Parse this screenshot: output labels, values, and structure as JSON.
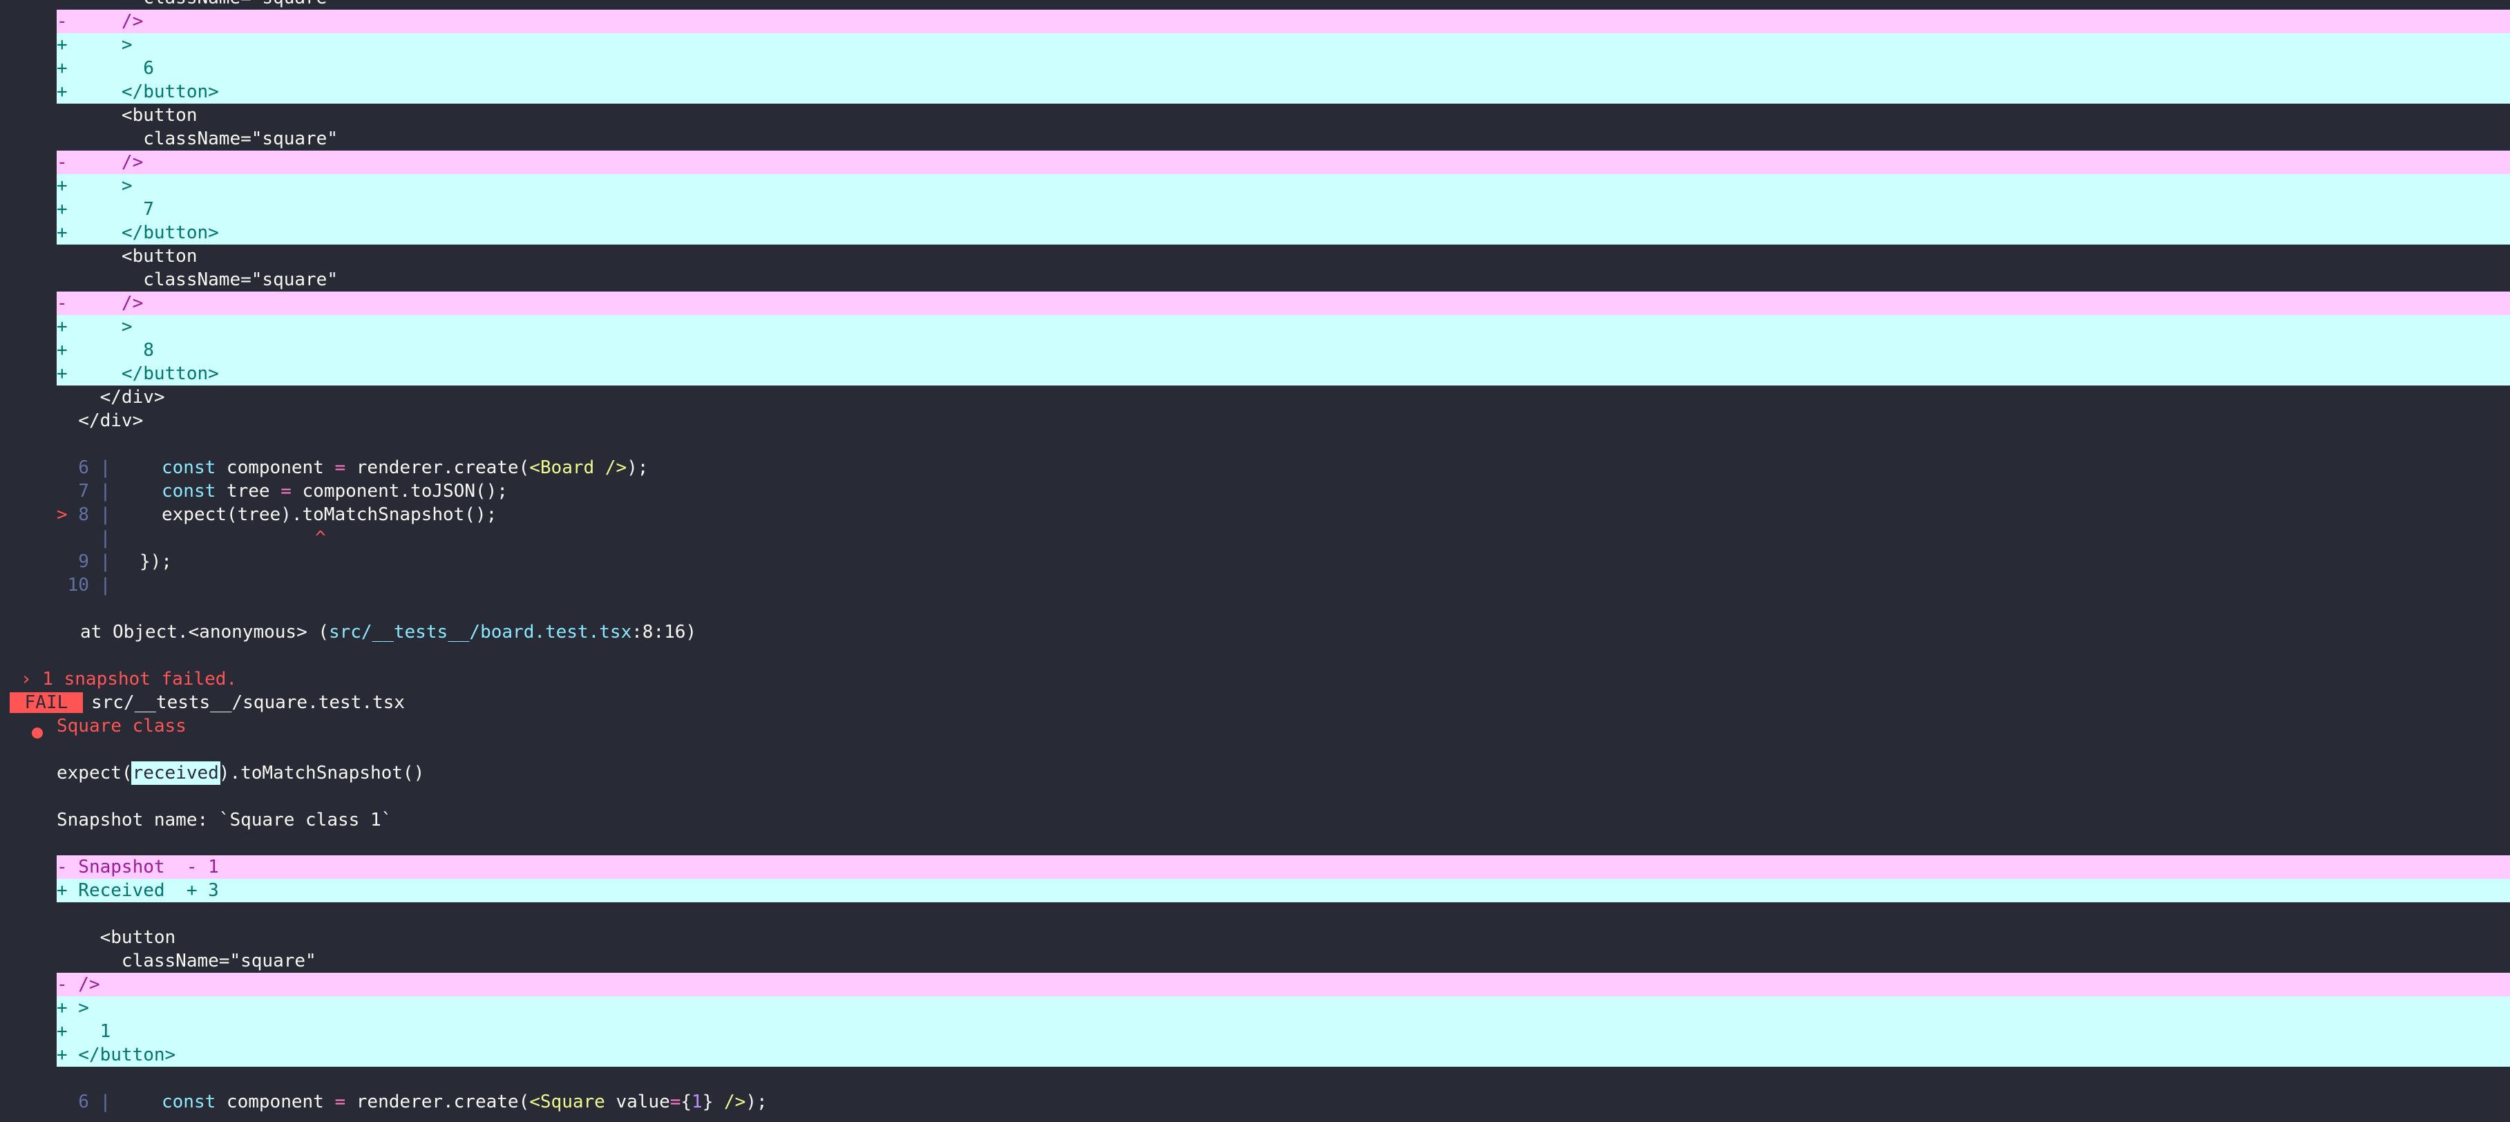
{
  "diff_lines": [
    {
      "kind": "plain",
      "text": "        className=\"square\""
    },
    {
      "kind": "del",
      "text": "-     />"
    },
    {
      "kind": "add",
      "text": "+     >"
    },
    {
      "kind": "add",
      "text": "+       6"
    },
    {
      "kind": "add",
      "text": "+     </button>"
    },
    {
      "kind": "plain",
      "text": "      <button"
    },
    {
      "kind": "plain",
      "text": "        className=\"square\""
    },
    {
      "kind": "del",
      "text": "-     />"
    },
    {
      "kind": "add",
      "text": "+     >"
    },
    {
      "kind": "add",
      "text": "+       7"
    },
    {
      "kind": "add",
      "text": "+     </button>"
    },
    {
      "kind": "plain",
      "text": "      <button"
    },
    {
      "kind": "plain",
      "text": "        className=\"square\""
    },
    {
      "kind": "del",
      "text": "-     />"
    },
    {
      "kind": "add",
      "text": "+     >"
    },
    {
      "kind": "add",
      "text": "+       8"
    },
    {
      "kind": "add",
      "text": "+     </button>"
    },
    {
      "kind": "plain",
      "text": "    </div>"
    },
    {
      "kind": "plain",
      "text": "  </div>"
    }
  ],
  "code_frame_1": {
    "l6": {
      "no": "6",
      "kw": "const",
      "a": " component ",
      "eq": "=",
      "b": " renderer.create(",
      "tag": "<Board />",
      "c": ");"
    },
    "l7": {
      "no": "7",
      "kw": "const",
      "a": " tree ",
      "eq": "=",
      "b": " component.toJSON();"
    },
    "l8": {
      "marker": ">",
      "no": "8",
      "a": "expect(tree).toMatchSnapshot();"
    },
    "caret": "^",
    "l9": {
      "no": "9",
      "a": "});"
    },
    "l10": {
      "no": "10"
    }
  },
  "stack": {
    "prefix": "at Object.<anonymous> (",
    "path": "src/__tests__/board.test.tsx",
    "pos": ":8:16)"
  },
  "summary_failed": "› 1 snapshot failed.",
  "fail_badge": " FAIL ",
  "fail_file": "src/__tests__/square.test.tsx",
  "test_name": "Square class",
  "expect_line": {
    "pre": "expect(",
    "recv": "received",
    "post": ").toMatchSnapshot()"
  },
  "snapshot_name": "Snapshot name: `Square class 1`",
  "legend": {
    "del": "- Snapshot  - 1",
    "add": "+ Received  + 3"
  },
  "diff2": [
    {
      "kind": "plain",
      "text": "    <button"
    },
    {
      "kind": "plain",
      "text": "      className=\"square\""
    },
    {
      "kind": "del",
      "text": "- />"
    },
    {
      "kind": "add",
      "text": "+ >"
    },
    {
      "kind": "add",
      "text": "+   1"
    },
    {
      "kind": "add",
      "text": "+ </button>"
    }
  ],
  "code_frame_2": {
    "l6": {
      "no": "6",
      "kw": "const",
      "a": " component ",
      "eq": "=",
      "b": " renderer.create(",
      "tag": "<Square",
      "attr": " value",
      "eq2": "=",
      "brace1": "{",
      "num": "1",
      "brace2": "}",
      "tag2": " />",
      "c": ");"
    }
  },
  "colors": {
    "background": "#282a36",
    "removed_band": "#ffcaff",
    "added_band": "#cdffff",
    "fail_red": "#ff5555"
  }
}
